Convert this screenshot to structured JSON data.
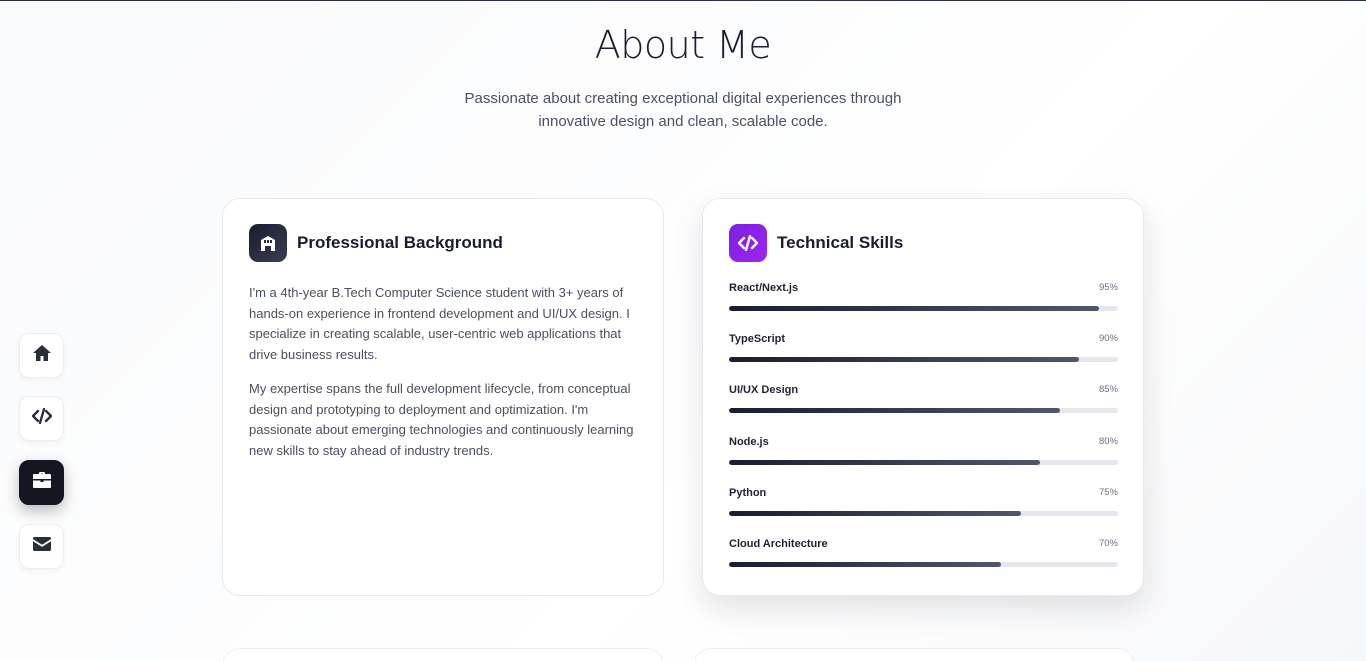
{
  "section": {
    "title": "About Me",
    "subtitle": "Passionate about creating exceptional digital experiences through innovative design and clean, scalable code."
  },
  "background_card": {
    "title": "Professional Background",
    "icon": "building-icon",
    "paragraphs": [
      "I'm a 4th-year B.Tech Computer Science student with 3+ years of hands-on experience in frontend development and UI/UX design. I specialize in creating scalable, user-centric web applications that drive business results.",
      "My expertise spans the full development lifecycle, from conceptual design and prototyping to deployment and optimization. I'm passionate about emerging technologies and continuously learning new skills to stay ahead of industry trends."
    ]
  },
  "skills_card": {
    "title": "Technical Skills",
    "icon": "code-icon",
    "accent": "#8a22e8",
    "skills": [
      {
        "name": "React/Next.js",
        "percent_label": "95%",
        "level": 95
      },
      {
        "name": "TypeScript",
        "percent_label": "90%",
        "level": 90
      },
      {
        "name": "UI/UX Design",
        "percent_label": "85%",
        "level": 85
      },
      {
        "name": "Node.js",
        "percent_label": "80%",
        "level": 80
      },
      {
        "name": "Python",
        "percent_label": "75%",
        "level": 75
      },
      {
        "name": "Cloud Architecture",
        "percent_label": "70%",
        "level": 70
      }
    ]
  },
  "side_nav": {
    "items": [
      {
        "icon": "home-icon",
        "active": false
      },
      {
        "icon": "code-icon",
        "active": false
      },
      {
        "icon": "briefcase-icon",
        "active": true
      },
      {
        "icon": "mail-icon",
        "active": false
      }
    ]
  }
}
